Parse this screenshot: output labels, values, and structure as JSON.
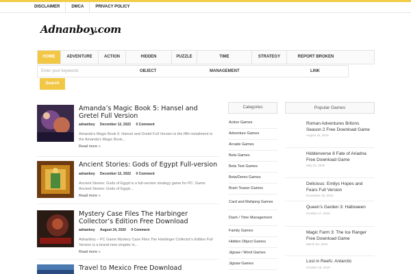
{
  "topbar": {
    "links": [
      "DISCLAIMER",
      "DMCA",
      "PRIVACY POLICY"
    ]
  },
  "logo": {
    "text": "Adnanboy.com"
  },
  "nav": {
    "row1": [
      "HOME",
      "ADVENTURE",
      "ACTION",
      "HIDDEN",
      "PUZZLE",
      "TIME",
      "STRATEGY",
      "REPORT BROKEN"
    ],
    "search_placeholder": "Enter your keywords",
    "row2": [
      "OBJECT",
      "MANAGEMENT",
      "LINK"
    ],
    "search_button": "Search"
  },
  "posts": [
    {
      "title": "Amanda’s Magic Book 5: Hansel and Gretel Full Version",
      "author": "adnanboy",
      "date": "December 12, 2022",
      "comments": "0 Comment",
      "excerpt": "Amanda's Magic Book 5: Hansel and Gretel Full Version is the fifth installment in the Amanda's Magic Book...",
      "more": "Read more »"
    },
    {
      "title": "Ancient Stories: Gods of Egypt Full-version",
      "author": "adnanboy",
      "date": "December 12, 2022",
      "comments": "0 Comment",
      "excerpt": "Ancient Stories: Gods of Egypt is a full-version strategy game for PC. Game Ancient Stories: Gods of Egypt...",
      "more": "Read more »"
    },
    {
      "title": "Mystery Case Files The Harbinger Collector’s Edition Free Download",
      "author": "adnanboy",
      "date": "August 24, 2020",
      "comments": "0 Comment",
      "excerpt": "Adnanboy – PC Game Mystery Case Files The Harbinger Collector's Edition Full Version is a brand-new chapter in...",
      "more": "Read more »"
    },
    {
      "title": "Travel to Mexico Free Download"
    }
  ],
  "categories": {
    "title": "Categories",
    "items": [
      "Action Games",
      "Adventure Games",
      "Arcade Games",
      "Beta Games",
      "Beta Test Games",
      "Beta/Demo Games",
      "Brain Teaser Games",
      "Card and Mahjong Games",
      "Dash / Time Management",
      "Family Games",
      "Hidden Object Games",
      "Jigsaw / Word Games",
      "Jigsaw Games"
    ]
  },
  "popular": {
    "title": "Popular Games",
    "items": [
      {
        "title": "Roman Adventures Britons Season 2 Free Download Game",
        "date": "August 16, 2019"
      },
      {
        "title": "Hiddenverse 8 Fate of Ariadna Free Download Game",
        "date": "May 04, 2020"
      },
      {
        "title": "Delicious: Emilys Hopes and Fears Full Version",
        "date": "November 25, 2019"
      },
      {
        "title": "Queen's Garden 3: Halloween",
        "date": "October 17, 2019"
      },
      {
        "title": "Magic Farm 3: The Ice Ranger Free Download Game",
        "date": "March 04, 2020"
      },
      {
        "title": "Lost in Reefs: Antarctic",
        "date": "October 19, 2019"
      }
    ]
  },
  "colors": {
    "accent": "#f2c746",
    "topline": "#f2cd45"
  }
}
